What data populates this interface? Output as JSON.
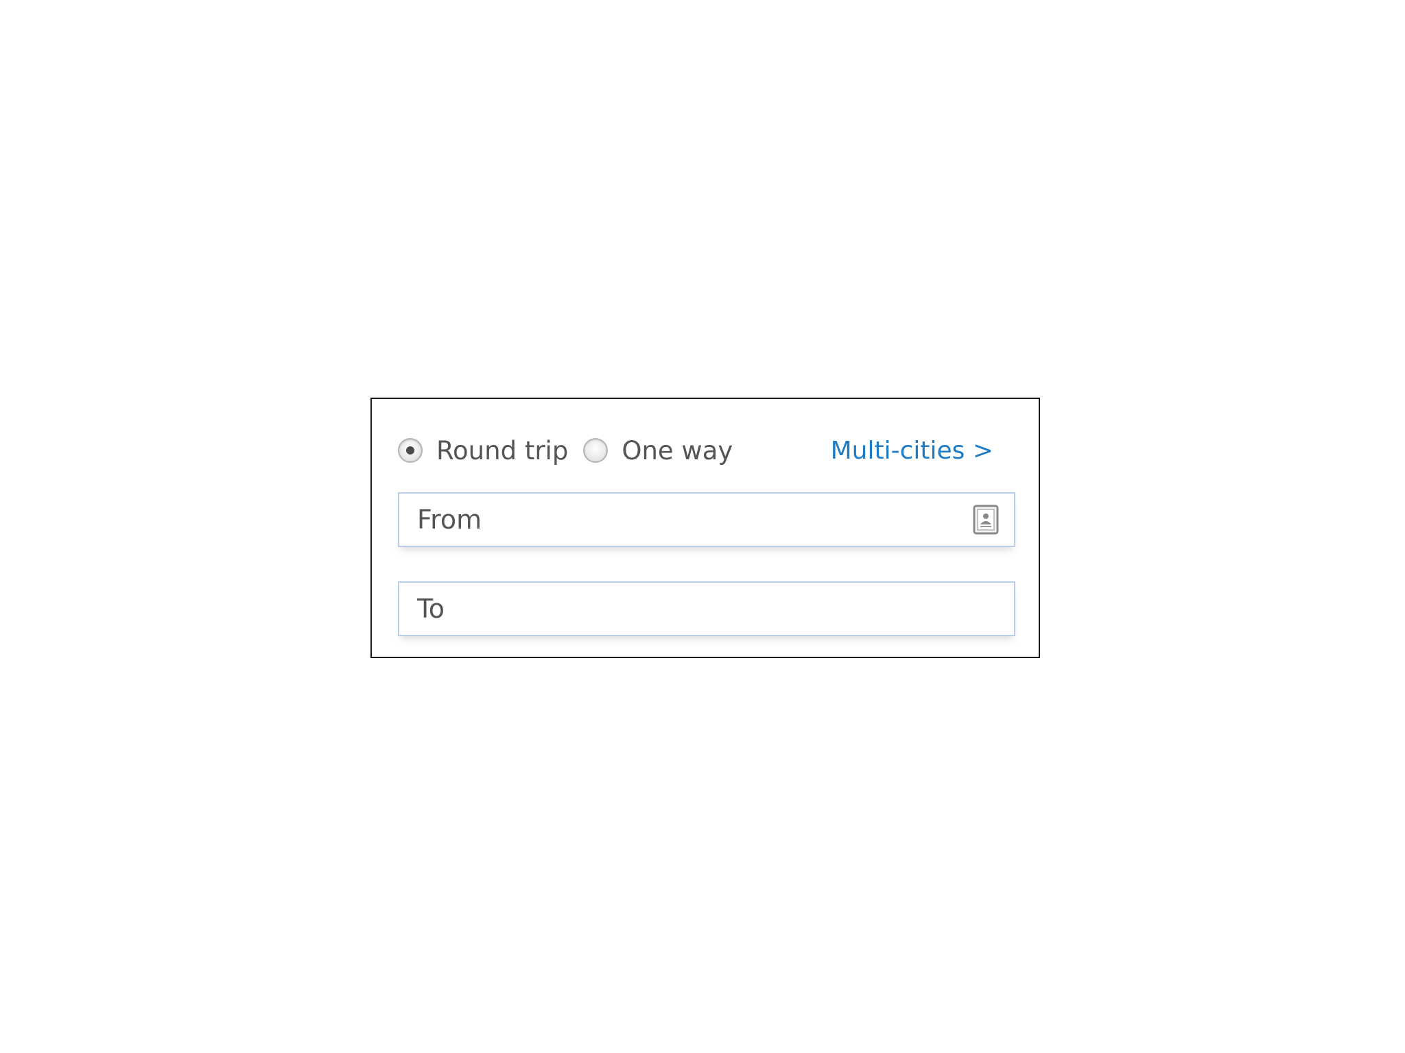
{
  "trip_type": {
    "options": [
      {
        "label": "Round trip",
        "selected": true
      },
      {
        "label": "One way",
        "selected": false
      }
    ],
    "multi_cities_link": "Multi-cities >"
  },
  "fields": {
    "from": {
      "placeholder": "From",
      "value": "",
      "icon": "address-book-icon"
    },
    "to": {
      "placeholder": "To",
      "value": ""
    }
  },
  "colors": {
    "link": "#1f7cc4",
    "field_border": "#b9cde6",
    "text": "#555555",
    "panel_border": "#1a1a1a"
  }
}
